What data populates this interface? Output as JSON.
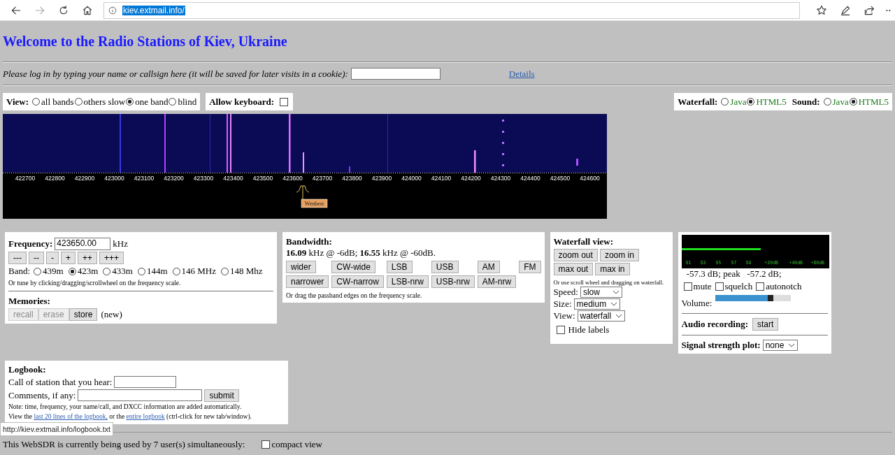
{
  "browser": {
    "url": "kiev.extmail.info/"
  },
  "title": "Welcome to the Radio Stations of Kiev, Ukraine",
  "login": {
    "prompt": "Please log in by typing your name or callsign here (it will be saved for later visits in a cookie):",
    "details_link": "Details"
  },
  "view": {
    "label": "View:",
    "options": [
      {
        "label": "all bands",
        "selected": false
      },
      {
        "label": "others slow",
        "selected": false
      },
      {
        "label": "one band",
        "selected": true
      },
      {
        "label": "blind",
        "selected": false
      }
    ]
  },
  "keyboard": {
    "label": "Allow keyboard:",
    "checked": false
  },
  "modes": [
    {
      "label": "Waterfall:",
      "options": [
        {
          "label": "Java",
          "selected": false
        },
        {
          "label": "HTML5",
          "selected": true
        }
      ]
    },
    {
      "label": "Sound:",
      "options": [
        {
          "label": "Java",
          "selected": false
        },
        {
          "label": "HTML5",
          "selected": true
        }
      ]
    }
  ],
  "spectrum": {
    "scale": [
      "422700",
      "422800",
      "422900",
      "423000",
      "423100",
      "423200",
      "423300",
      "423400",
      "423500",
      "423600",
      "423700",
      "423800",
      "423900",
      "424000",
      "424100",
      "424200",
      "424300",
      "424400",
      "424500",
      "424600"
    ],
    "station_label": "Wenbest"
  },
  "frequency": {
    "label": "Frequency:",
    "value": "423650.00",
    "unit": "kHz",
    "step_buttons": [
      "---",
      "--",
      "-",
      "+",
      "++",
      "+++"
    ],
    "band_label": "Band:",
    "bands": [
      {
        "label": "439m",
        "selected": false
      },
      {
        "label": "423m",
        "selected": true
      },
      {
        "label": "433m",
        "selected": false
      },
      {
        "label": "144m",
        "selected": false
      },
      {
        "label": "146 MHz",
        "selected": false
      },
      {
        "label": "148 Mhz",
        "selected": false
      }
    ],
    "hint": "Or tune by clicking/dragging/scrollwheel on the frequency scale."
  },
  "memories": {
    "label": "Memories:",
    "buttons": [
      {
        "label": "recall",
        "disabled": true
      },
      {
        "label": "erase",
        "disabled": true
      },
      {
        "label": "store",
        "disabled": false
      }
    ],
    "note": "(new)"
  },
  "bandwidth": {
    "label": "Bandwidth:",
    "reading": "**16.09** kHz @ -6dB; **16.55** kHz @ -60dB.",
    "button_rows": [
      [
        "wider",
        "CW-wide",
        "LSB",
        "USB",
        "AM",
        "FM"
      ],
      [
        "narrower",
        "CW-narrow",
        "LSB-nrw",
        "USB-nrw",
        "AM-nrw"
      ]
    ],
    "hint": "Or drag the passband edges on the frequency scale."
  },
  "waterfall_view": {
    "label": "Waterfall view:",
    "button_rows": [
      [
        "zoom out",
        "zoom in"
      ],
      [
        "max out",
        "max in"
      ]
    ],
    "hint": "Or use scroll wheel and dragging on waterfall.",
    "selects": [
      {
        "label": "Speed:",
        "value": "slow"
      },
      {
        "label": "Size:",
        "value": "medium"
      },
      {
        "label": "View:",
        "value": "waterfall"
      }
    ],
    "hide_labels": {
      "label": "Hide labels",
      "checked": false
    }
  },
  "audio": {
    "smeter": {
      "level": 0.54,
      "scale": [
        "S1",
        "S3",
        "S5",
        "S7",
        "S9",
        "+20dB",
        "+40dB",
        "+60dB"
      ]
    },
    "reading": " -57.3 dB; peak   -57.2 dB;",
    "checkboxes": [
      {
        "label": "mute",
        "checked": false
      },
      {
        "label": "squelch",
        "checked": false
      },
      {
        "label": "autonotch",
        "checked": false
      }
    ],
    "volume": {
      "label": "Volume:",
      "level": 0.73
    },
    "recording": {
      "label": "Audio recording:",
      "button": "start"
    },
    "plot": {
      "label": "Signal strength plot:",
      "value": "none"
    }
  },
  "logbook": {
    "label": "Logbook:",
    "call_label": "Call of station that you hear:",
    "comments_label": "Comments, if any:",
    "submit": "submit",
    "note": "Note: time, frequency, your name/call, and DXCC information are added automatically.",
    "view_sentence": [
      {
        "kind": "text",
        "text": "View the "
      },
      {
        "kind": "link",
        "text": "last 20 lines of the logbook,"
      },
      {
        "kind": "text",
        "text": " or the "
      },
      {
        "kind": "link",
        "text": "entire logbook"
      },
      {
        "kind": "text",
        "text": " (ctrl-click for new tab/window)."
      }
    ]
  },
  "link_tooltip": "http://kiev.extmail.info/logbook.txt",
  "status": {
    "text": "This WebSDR is currently being used by 7 user(s) simultaneously:",
    "compact_view": {
      "label": "compact view",
      "checked": false
    }
  }
}
